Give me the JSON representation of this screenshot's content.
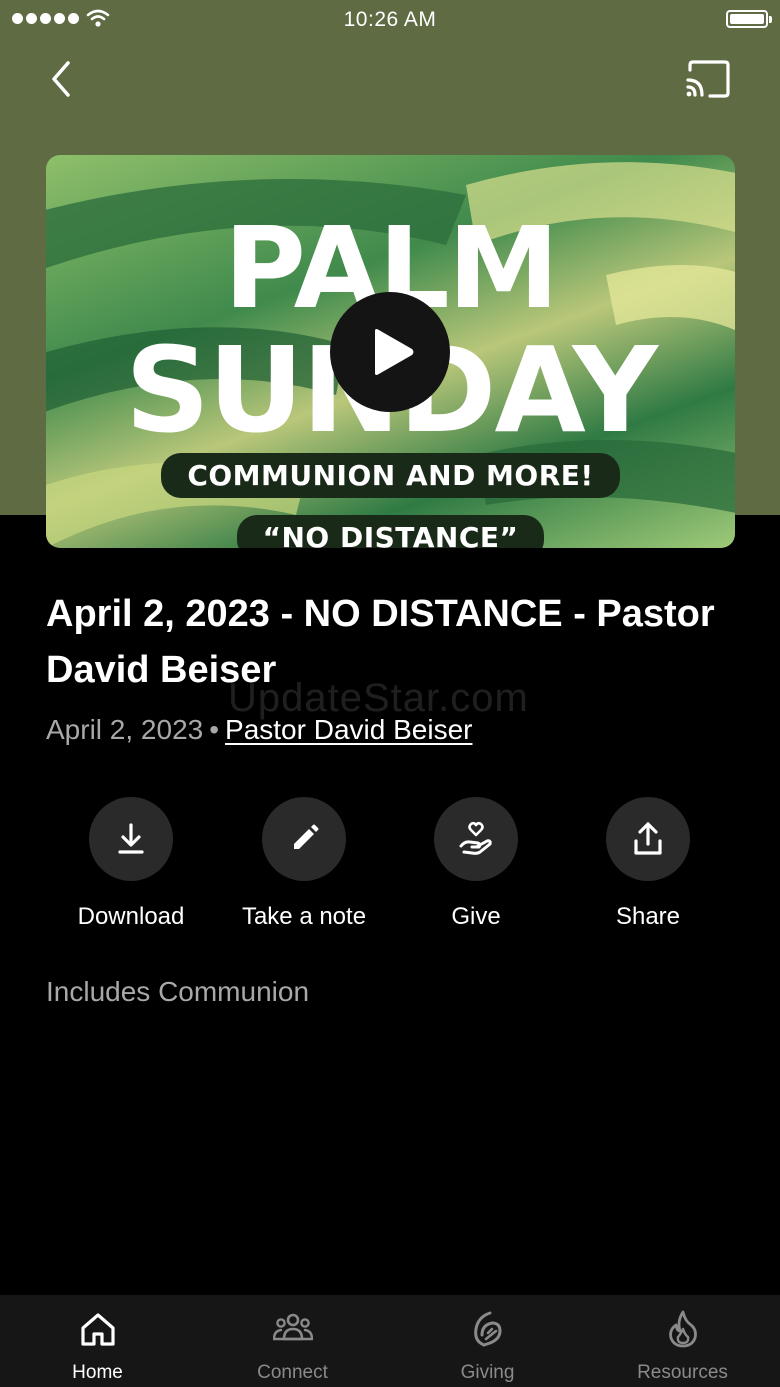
{
  "status_bar": {
    "time": "10:26 AM"
  },
  "hero": {
    "title_line1": "PALM",
    "title_line2": "SUNDAY",
    "subtitle": "COMMUNION AND MORE!",
    "series_title": "“NO DISTANCE”"
  },
  "sermon": {
    "title": "April 2, 2023 - NO DISTANCE - Pastor David Beiser",
    "date": "April 2, 2023",
    "separator": "•",
    "speaker": "Pastor David Beiser",
    "description": "Includes Communion"
  },
  "watermark": "UpdateStar.com",
  "actions": [
    {
      "label": "Download",
      "icon": "download-icon"
    },
    {
      "label": "Take a note",
      "icon": "pencil-icon"
    },
    {
      "label": "Give",
      "icon": "heart-hand-icon"
    },
    {
      "label": "Share",
      "icon": "share-icon"
    }
  ],
  "tabs": [
    {
      "label": "Home",
      "icon": "home-icon",
      "active": true
    },
    {
      "label": "Connect",
      "icon": "people-icon",
      "active": false
    },
    {
      "label": "Giving",
      "icon": "giving-icon",
      "active": false
    },
    {
      "label": "Resources",
      "icon": "flame-icon",
      "active": false
    }
  ],
  "colors": {
    "header_bg": "#5f6b42",
    "page_bg": "#000000",
    "action_circle": "#2a2a2a",
    "tab_bar": "#161616"
  }
}
